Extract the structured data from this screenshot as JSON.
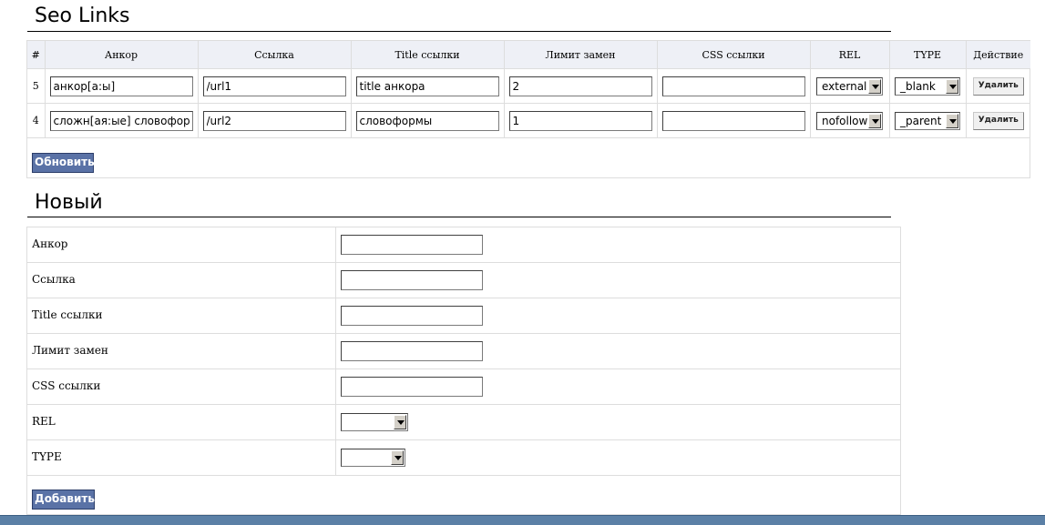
{
  "seo_links": {
    "title": "Seo Links",
    "columns": [
      "#",
      "Анкор",
      "Ссылка",
      "Title ссылки",
      "Лимит замен",
      "CSS ссылки",
      "REL",
      "TYPE",
      "Действие"
    ],
    "rows": [
      {
        "id": "5",
        "anchor": "анкор[а:ы]",
        "url": "/url1",
        "title": "title анкора",
        "limit": "2",
        "css": "",
        "rel": "external",
        "type": "_blank",
        "action": "Удалить"
      },
      {
        "id": "4",
        "anchor": "сложн[ая:ые] словоформ",
        "url": "/url2",
        "title": "словоформы",
        "limit": "1",
        "css": "",
        "rel": "nofollow",
        "type": "_parent",
        "action": "Удалить"
      }
    ],
    "update_button": "Обновить"
  },
  "new_form": {
    "title": "Новый",
    "labels": {
      "anchor": "Анкор",
      "url": "Ссылка",
      "title": "Title ссылки",
      "limit": "Лимит замен",
      "css": "CSS ссылки",
      "rel": "REL",
      "type": "TYPE"
    },
    "values": {
      "anchor": "",
      "url": "",
      "title": "",
      "limit": "",
      "css": "",
      "rel": "",
      "type": ""
    },
    "add_button": "Добавить"
  },
  "colors": {
    "header_bg": "#eef0f6",
    "button_blue": "#5a72a6",
    "bottom_bar": "#5b80a6",
    "border": "#dddddd"
  }
}
